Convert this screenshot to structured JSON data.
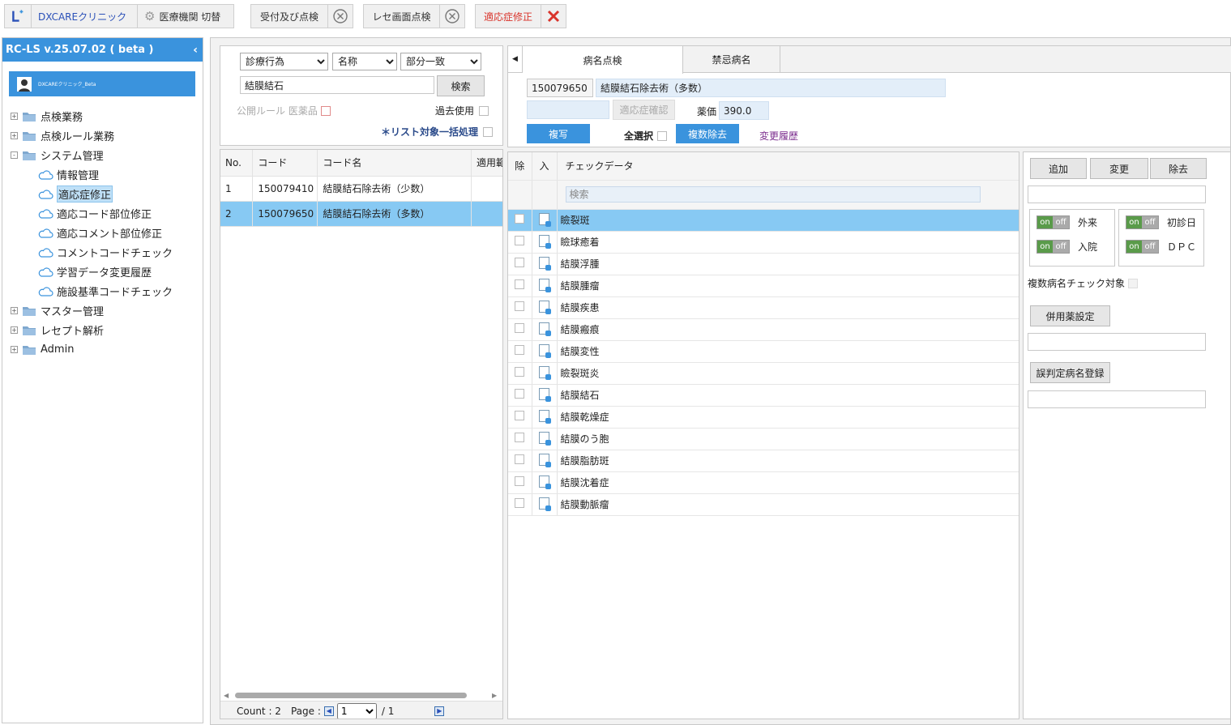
{
  "topbar": {
    "clinic": "DXCAREクリニック",
    "switch": "医療機関 切替",
    "tabs": [
      "受付及び点検",
      "レセ画面点検",
      "適応症修正"
    ]
  },
  "sidebar": {
    "version": "RC-LS v.25.07.02 ( beta )",
    "user": "DXCAREクリニック_Beta",
    "tree": [
      {
        "label": "点検業務",
        "type": "folder",
        "state": "+"
      },
      {
        "label": "点検ルール業務",
        "type": "folder",
        "state": "+"
      },
      {
        "label": "システム管理",
        "type": "folder",
        "state": "-"
      },
      {
        "label": "情報管理",
        "type": "cloud"
      },
      {
        "label": "適応症修正",
        "type": "cloud",
        "selected": true
      },
      {
        "label": "適応コード部位修正",
        "type": "cloud"
      },
      {
        "label": "適応コメント部位修正",
        "type": "cloud"
      },
      {
        "label": "コメントコードチェック",
        "type": "cloud"
      },
      {
        "label": "学習データ変更履歴",
        "type": "cloud"
      },
      {
        "label": "施設基準コードチェック",
        "type": "cloud"
      },
      {
        "label": "マスター管理",
        "type": "folder",
        "state": "+"
      },
      {
        "label": "レセプト解析",
        "type": "folder",
        "state": "+"
      },
      {
        "label": "Admin",
        "type": "folder",
        "state": "+"
      }
    ]
  },
  "search": {
    "type": "診療行為",
    "field": "名称",
    "match": "部分一致",
    "query": "結膜結石",
    "search_btn": "検索",
    "public_rule": "公開ルール 医薬品",
    "past_use": "過去使用",
    "batch": "＊リスト対象一括処理"
  },
  "list": {
    "headers": [
      "No.",
      "コード",
      "コード名",
      "適用範"
    ],
    "rows": [
      {
        "no": "1",
        "code": "150079410",
        "name": "結膜結石除去術（少数）"
      },
      {
        "no": "2",
        "code": "150079650",
        "name": "結膜結石除去術（多数）"
      }
    ],
    "count": "Count : 2",
    "page_label": "Page :",
    "page": "1",
    "total": "/ 1"
  },
  "detail": {
    "tabs": [
      "病名点検",
      "禁忌病名"
    ],
    "code": "150079650",
    "name": "結膜結石除去術（多数）",
    "confirm_btn": "適応症確認",
    "price_label": "薬価",
    "price": "390.0",
    "copy_btn": "複写",
    "select_all": "全選択",
    "multi_remove": "複数除去",
    "history": "変更履歴"
  },
  "checkgrid": {
    "headers": [
      "除",
      "入",
      "チェックデータ"
    ],
    "filter_placeholder": "検索",
    "rows": [
      "瞼裂斑",
      "瞼球癒着",
      "結膜浮腫",
      "結膜腫瘤",
      "結膜疾患",
      "結膜瘢痕",
      "結膜変性",
      "瞼裂斑炎",
      "結膜結石",
      "結膜乾燥症",
      "結膜のう胞",
      "結膜脂肪斑",
      "結膜沈着症",
      "結膜動脈瘤"
    ]
  },
  "right": {
    "add": "追加",
    "change": "変更",
    "remove": "除去",
    "toggles": [
      "外来",
      "入院",
      "初診日",
      "ＤＰＣ"
    ],
    "on": "on",
    "off": "off",
    "multi_check": "複数病名チェック対象",
    "concomitant": "併用薬設定",
    "misjudge": "誤判定病名登録"
  },
  "colors": {
    "accent": "#3a93dd",
    "selected_row": "#87c9f3",
    "danger": "#d9342b"
  }
}
